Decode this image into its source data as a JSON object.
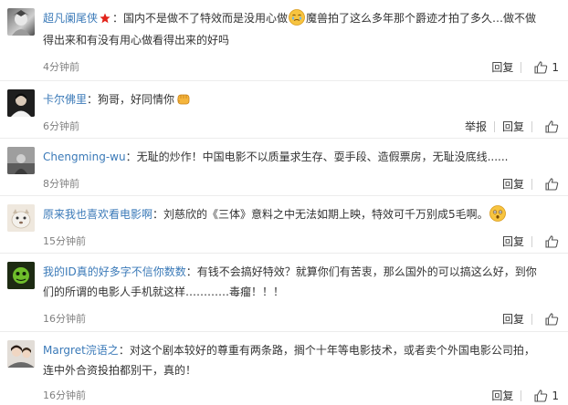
{
  "comments": [
    {
      "user": "超凡阑尾侠",
      "text_before": "：国内不是做不了特效而是没用心做",
      "text_after": "魔兽拍了这么多年那个爵迹才拍了多久…做不做得出来和有没有用心做看得出来的好吗",
      "time": "4分钟前",
      "reply": "回复",
      "likes": "1"
    },
    {
      "user": "卡尔佛里",
      "text_before": "：狗哥，好同情你",
      "text_after": "",
      "time": "6分钟前",
      "report": "举报",
      "reply": "回复"
    },
    {
      "user": "Chengming-wu",
      "text_before": "：无耻的炒作！中国电影不以质量求生存、耍手段、造假票房，无耻没底线......",
      "text_after": "",
      "time": "8分钟前",
      "reply": "回复"
    },
    {
      "user": "原来我也喜欢看电影啊",
      "text_before": "：刘慈欣的《三体》意料之中无法如期上映，特效可千万别成5毛啊。",
      "text_after": "",
      "time": "15分钟前",
      "reply": "回复"
    },
    {
      "user": "我的ID真的好多字不信你数数",
      "text_before": "：有钱不会搞好特效？就算你们有苦衷，那么国外的可以搞这么好，到你们的所谓的电影人手机就这样…………毒瘤！！！",
      "text_after": "",
      "time": "16分钟前",
      "reply": "回复"
    },
    {
      "user": "Margret浣语之",
      "text_before": "：对这个剧本较好的尊重有两条路，搁个十年等电影技术，或者卖个外国电影公司拍，连中外合资投拍都别干，真的！",
      "text_after": "",
      "time": "16分钟前",
      "reply": "回复",
      "likes": "1"
    }
  ],
  "colors": {
    "username": "#3b7ab8",
    "text": "#333333",
    "time": "#808080",
    "divider": "#ececec"
  }
}
